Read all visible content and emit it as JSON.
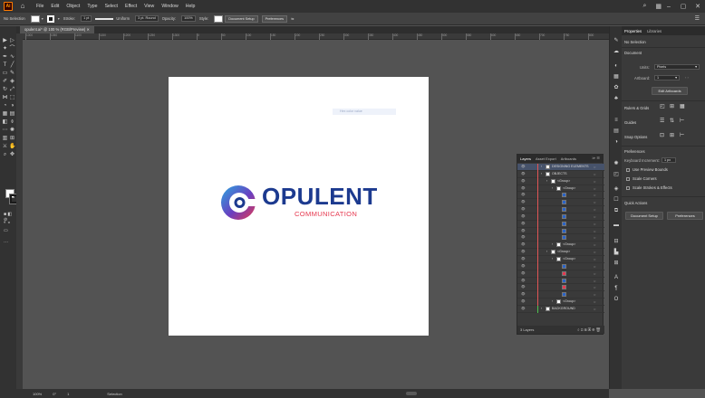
{
  "menubar": {
    "logo": "Ai",
    "items": [
      "File",
      "Edit",
      "Object",
      "Type",
      "Select",
      "Effect",
      "View",
      "Window",
      "Help"
    ]
  },
  "controlbar": {
    "selection": "No Selection",
    "stroke_label": "Stroke:",
    "stroke_value": "1 pt",
    "stroke_type": "Uniform",
    "brush": "3 pt. Round",
    "opacity_label": "Opacity:",
    "opacity_value": "100%",
    "style_label": "Style:",
    "doc_setup": "Document Setup",
    "preferences": "Preferences"
  },
  "tab": {
    "title": "opulent.ai* @ 100 % (RGB/Preview)"
  },
  "ruler": {
    "ticks": [
      "1000",
      "1050",
      "1100",
      "1150",
      "1200",
      "1250",
      "1300",
      "0",
      "50",
      "100",
      "150",
      "200",
      "250",
      "300",
      "350",
      "400",
      "450",
      "500",
      "550",
      "600",
      "650",
      "700",
      "750",
      "800"
    ]
  },
  "canvas": {
    "search_placeholder": "Hex color value",
    "logo_word": "OPULENT",
    "logo_sub": "COMMUNICATION"
  },
  "layers": {
    "tabs": [
      "Layers",
      "Asset Export",
      "Artboards"
    ],
    "rows": [
      {
        "name": "DESIGNING ELEMENTS",
        "indent": 0
      },
      {
        "name": "OBJECTS",
        "indent": 0
      },
      {
        "name": "<Group>",
        "indent": 1
      },
      {
        "name": "<Group>",
        "indent": 2
      },
      {
        "name": "",
        "indent": 3
      },
      {
        "name": "",
        "indent": 3
      },
      {
        "name": "",
        "indent": 3
      },
      {
        "name": "",
        "indent": 3
      },
      {
        "name": "",
        "indent": 3
      },
      {
        "name": "",
        "indent": 3
      },
      {
        "name": "",
        "indent": 3
      },
      {
        "name": "<Group>",
        "indent": 2
      },
      {
        "name": "<Group>",
        "indent": 1
      },
      {
        "name": "<Group>",
        "indent": 2
      },
      {
        "name": "",
        "indent": 3
      },
      {
        "name": "",
        "indent": 3
      },
      {
        "name": "",
        "indent": 3
      },
      {
        "name": "",
        "indent": 3
      },
      {
        "name": "",
        "indent": 3
      },
      {
        "name": "<Group>",
        "indent": 2
      },
      {
        "name": "BACKGROUND",
        "indent": 0
      }
    ],
    "footer": "3 Layers"
  },
  "properties": {
    "tabs": [
      "Properties",
      "Libraries"
    ],
    "no_selection": "No Selection",
    "document": "Document",
    "units_label": "Units:",
    "units_value": "Pixels",
    "artboard_label": "Artboard:",
    "artboard_value": "1",
    "edit_artboards": "Edit Artboards",
    "rulers_grids": "Rulers & Grids",
    "guides": "Guides",
    "snap_options": "Snap Options",
    "preferences": "Preferences",
    "keyboard_increment_label": "Keyboard Increment:",
    "keyboard_increment_value": "1 px",
    "use_preview_bounds": "Use Preview Bounds",
    "scale_corners": "Scale Corners",
    "scale_strokes": "Scale Strokes & Effects",
    "quick_actions": "Quick Actions",
    "doc_setup": "Document Setup",
    "prefs_btn": "Preferences"
  },
  "statusbar": {
    "zoom": "100%",
    "rotate": "0°",
    "artboard": "1",
    "tool": "Selection"
  },
  "colors": {
    "logo_blue": "#1c3a8f",
    "logo_red": "#e63950",
    "logo_cyan": "#2aa6e0"
  }
}
